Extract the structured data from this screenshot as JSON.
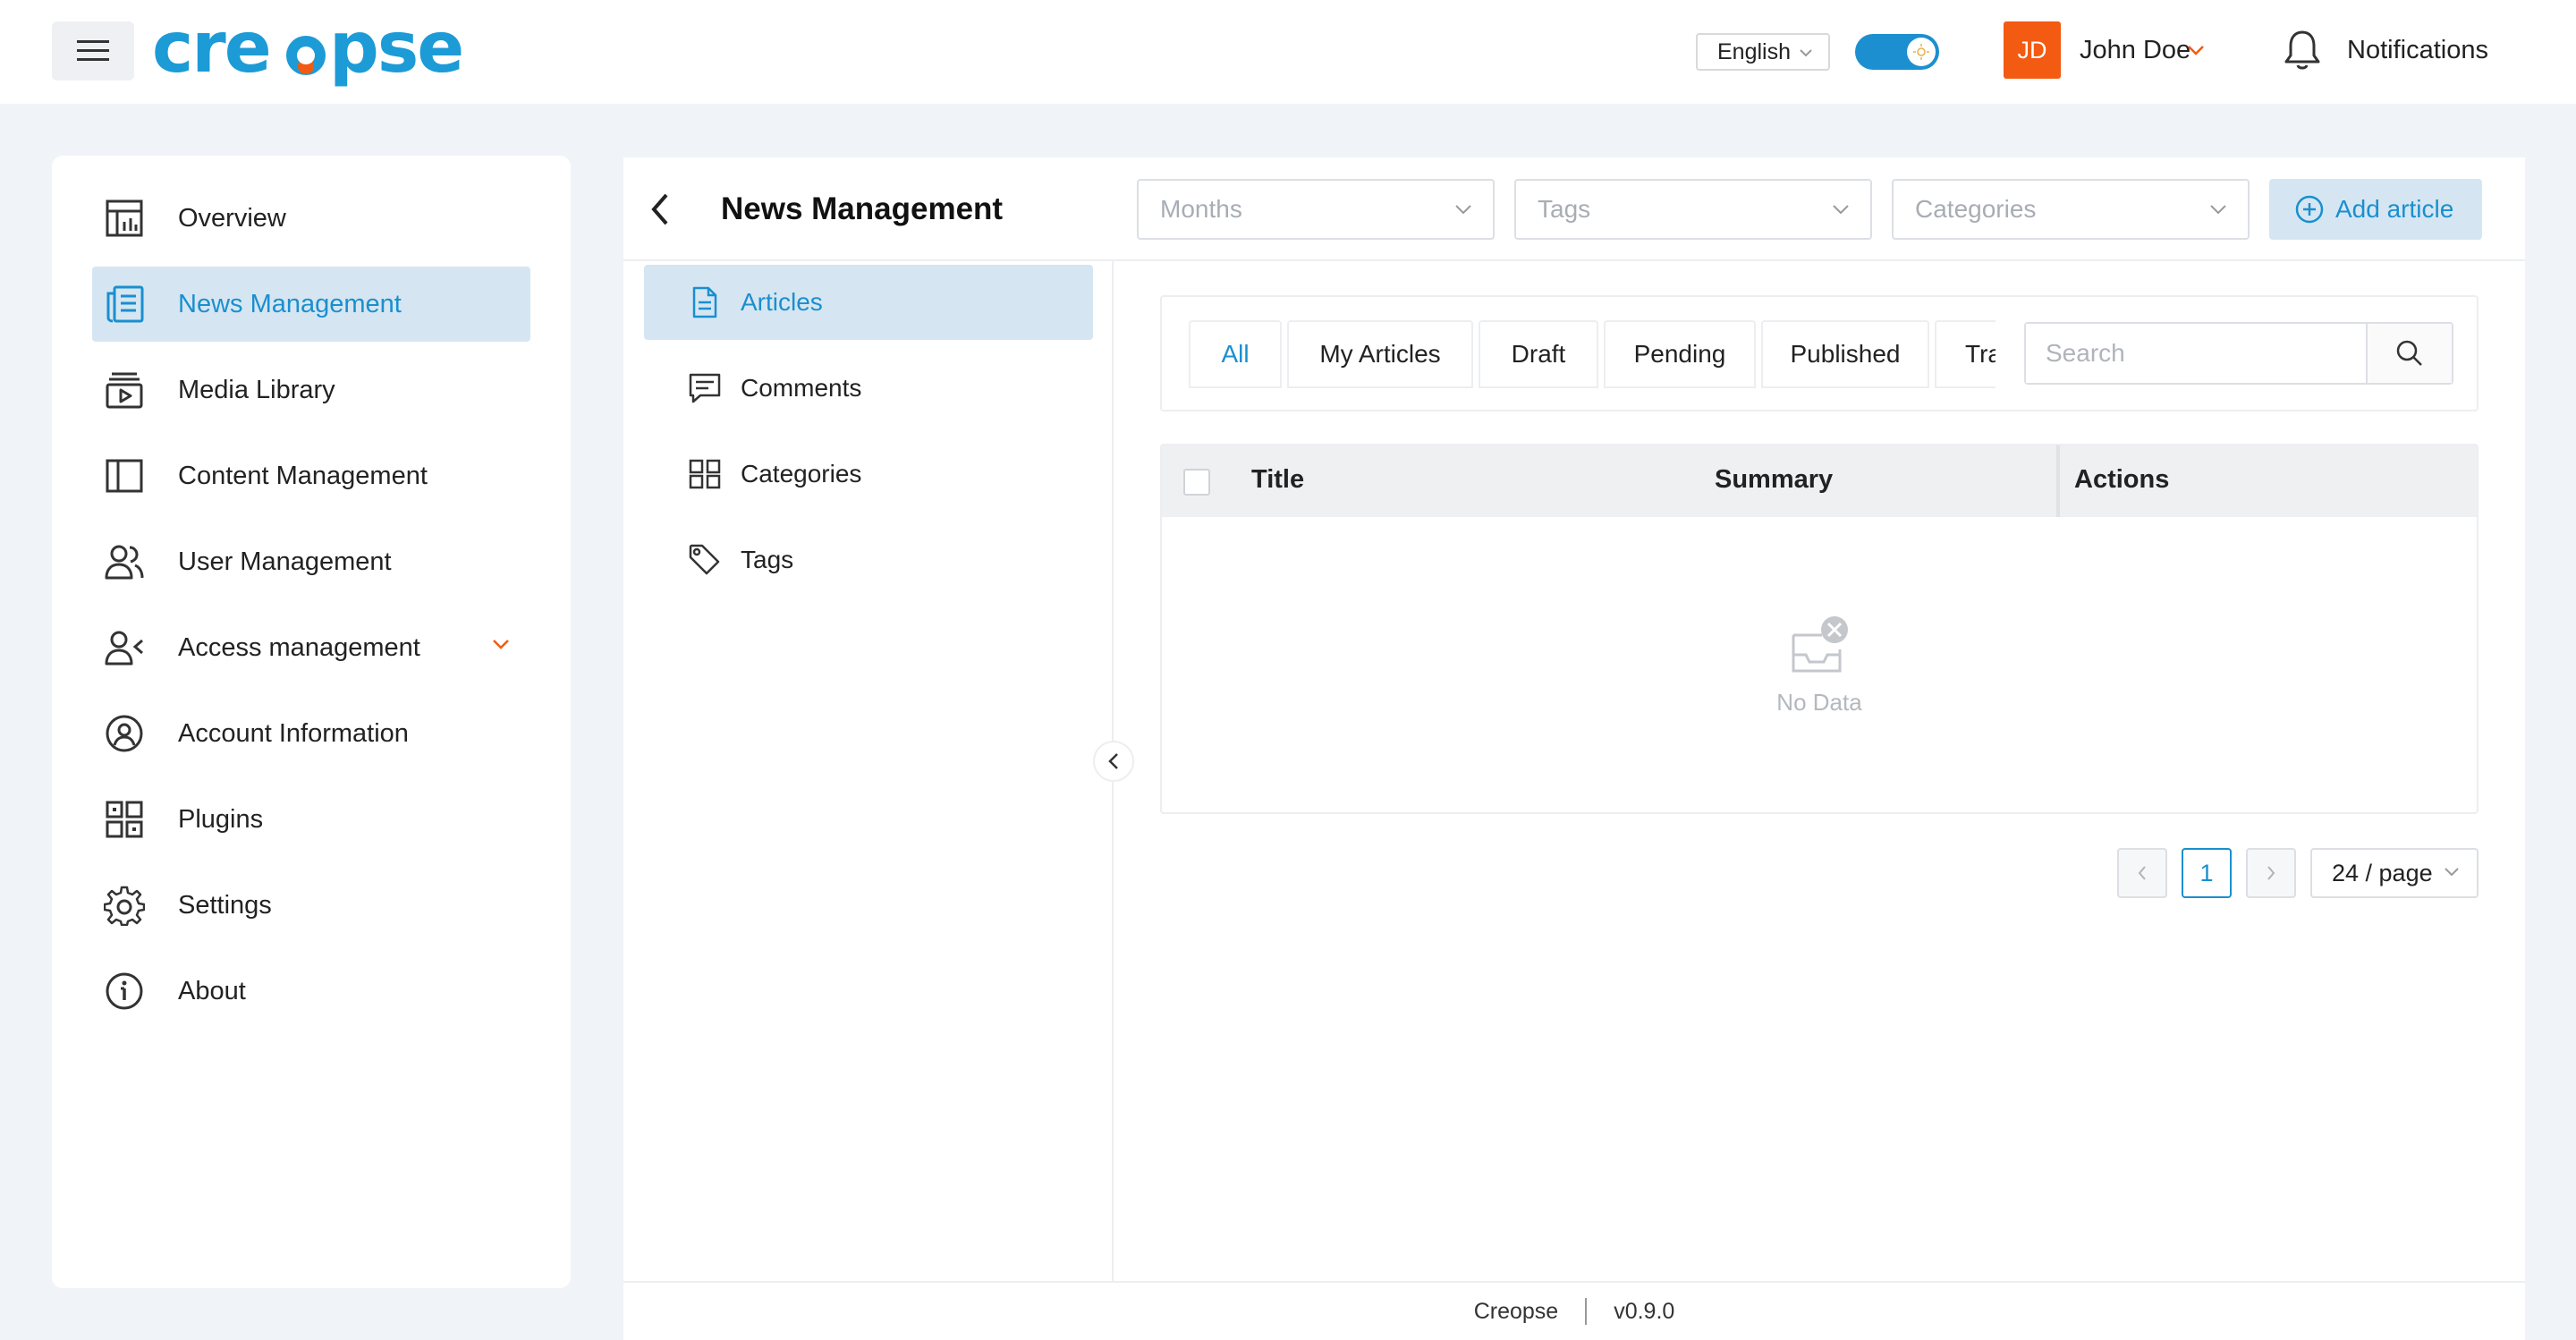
{
  "topbar": {
    "brand": "creopse",
    "language": "English",
    "user_initials": "JD",
    "user_name": "John Doe",
    "notifications_label": "Notifications",
    "accent_color": "#1c9bd6",
    "avatar_color": "#f35a12"
  },
  "sidebar": {
    "items": [
      {
        "label": "Overview",
        "icon": "overview-icon",
        "active": false
      },
      {
        "label": "News Management",
        "icon": "news-icon",
        "active": true
      },
      {
        "label": "Media Library",
        "icon": "media-icon",
        "active": false
      },
      {
        "label": "Content Management",
        "icon": "content-icon",
        "active": false
      },
      {
        "label": "User Management",
        "icon": "users-icon",
        "active": false
      },
      {
        "label": "Access management",
        "icon": "access-icon",
        "active": false,
        "expandable": true
      },
      {
        "label": "Account Information",
        "icon": "account-icon",
        "active": false
      },
      {
        "label": "Plugins",
        "icon": "plugins-icon",
        "active": false
      },
      {
        "label": "Settings",
        "icon": "gear-icon",
        "active": false
      },
      {
        "label": "About",
        "icon": "info-icon",
        "active": false
      }
    ]
  },
  "main": {
    "title": "News Management",
    "filters": {
      "months_placeholder": "Months",
      "tags_placeholder": "Tags",
      "categories_placeholder": "Categories"
    },
    "add_button": "Add article",
    "submenu": [
      {
        "label": "Articles",
        "icon": "document-icon",
        "active": true
      },
      {
        "label": "Comments",
        "icon": "comment-icon",
        "active": false
      },
      {
        "label": "Categories",
        "icon": "grid-icon",
        "active": false
      },
      {
        "label": "Tags",
        "icon": "tag-icon",
        "active": false
      }
    ],
    "tabs": [
      {
        "label": "All",
        "active": true
      },
      {
        "label": "My Articles",
        "active": false
      },
      {
        "label": "Draft",
        "active": false
      },
      {
        "label": "Pending",
        "active": false
      },
      {
        "label": "Published",
        "active": false
      },
      {
        "label": "Trash",
        "active": false
      }
    ],
    "search_placeholder": "Search",
    "table": {
      "columns": [
        "Title",
        "Summary",
        "Actions"
      ],
      "empty_text": "No Data"
    },
    "pagination": {
      "current_page": "1",
      "page_size": "24 / page"
    }
  },
  "footer": {
    "app_name": "Creopse",
    "version": "v0.9.0"
  }
}
